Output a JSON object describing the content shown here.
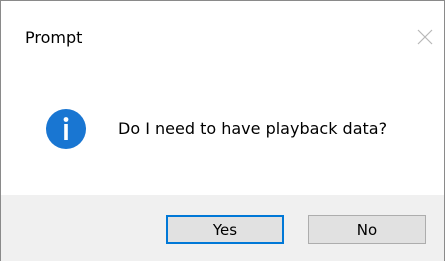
{
  "window": {
    "title": "Prompt",
    "close_icon": "close-icon"
  },
  "message": {
    "icon": "info-icon",
    "text": "Do I need to have playback data?"
  },
  "buttons": {
    "yes_label": "Yes",
    "no_label": "No"
  },
  "colors": {
    "info_icon_blue": "#1976d2",
    "default_button_border": "#0078d7",
    "button_bar_background": "#f0f0f0"
  }
}
